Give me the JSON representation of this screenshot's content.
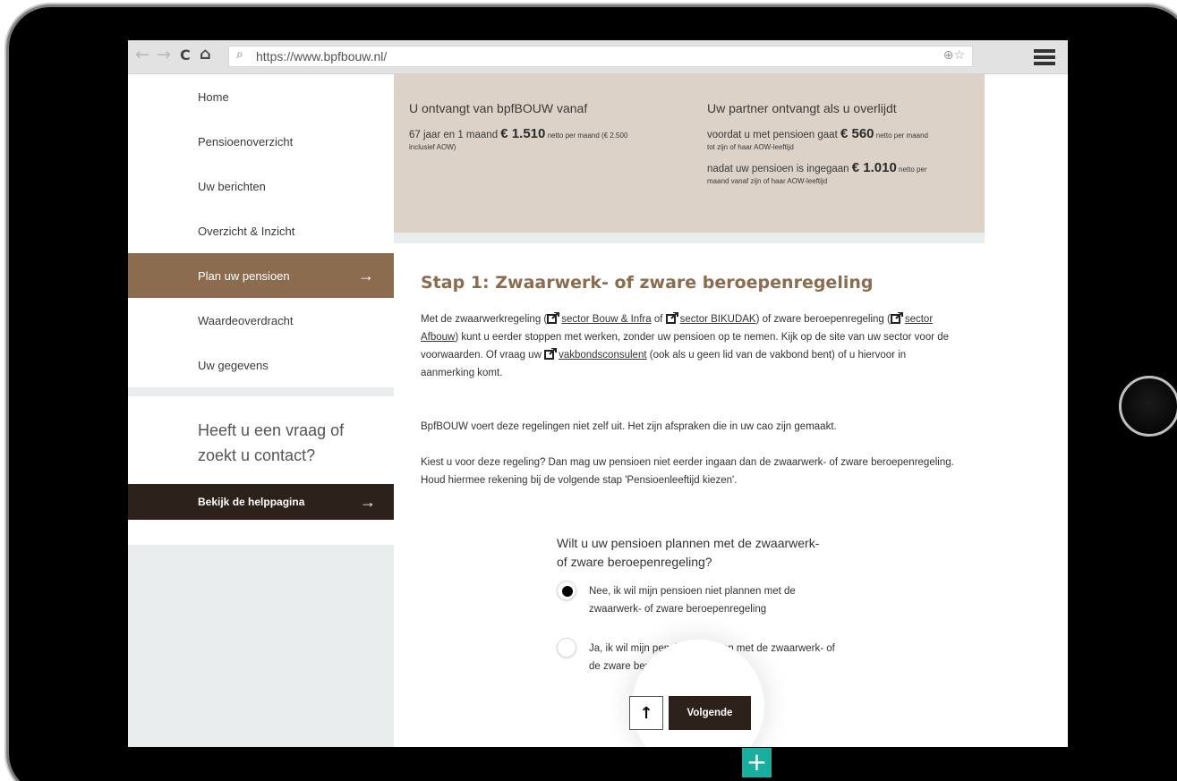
{
  "browser": {
    "back": "←",
    "forward": "→",
    "reload": "C",
    "home": "⌂",
    "url": "https://www.bpfbouw.nl/",
    "url_icons": "⊕☆"
  },
  "sidebar": {
    "items": [
      {
        "label": "Home"
      },
      {
        "label": "Pensioenoverzicht"
      },
      {
        "label": "Uw berichten"
      },
      {
        "label": "Overzicht & Inzicht"
      },
      {
        "label": "Plan uw pensioen",
        "arrow": "→"
      },
      {
        "label": "Waardeoverdracht"
      },
      {
        "label": "Uw gegevens"
      }
    ],
    "help_title": "Heeft u een vraag of zoekt u contact?",
    "help_button": "Bekijk de helppagina",
    "help_arrow": "→"
  },
  "benefit": {
    "left_head": "U ontvangt van bpfBOUW vanaf",
    "left_prefix": "67 jaar en 1 maand ",
    "left_amount": "€ 1.510",
    "left_suffix": " netto per maand (€ 2.500",
    "left_small": "inclusief AOW)",
    "right_head": "Uw partner ontvangt als u overlijdt",
    "right1_prefix": "voordat u met pensioen gaat ",
    "right1_amount": "€ 560",
    "right1_suffix": " netto per maand",
    "right1_small": "tot zijn of haar AOW-leeftijd",
    "right2_prefix": "nadat uw pensioen is ingegaan ",
    "right2_amount": "€ 1.010",
    "right2_suffix": " netto per",
    "right2_small": "maand vanaf zijn of haar AOW-leeftijd"
  },
  "main": {
    "step_title": "Stap 1: Zwaarwerk- of zware beroepenregeling",
    "p1_a": "Met de zwaarwerkregeling (",
    "link1": "sector Bouw & Infra",
    "p1_b": " of ",
    "link2": "sector BIKUDAK",
    "p1_c": ") of zware beroepenregeling (",
    "link3": "sector Afbouw",
    "p1_d": ") kunt u eerder stoppen met werken, zonder uw pensioen op te nemen. Kijk op de site van uw sector voor de voorwaarden. Of vraag uw ",
    "link4": "vakbondsconsulent",
    "p1_e": " (ook als u geen lid van de vakbond bent) of u hiervoor in aanmerking komt.",
    "p2": "BpfBOUW voert deze regelingen niet zelf uit. Het zijn afspraken die in uw cao zijn gemaakt.",
    "p3": "Kiest u voor deze regeling? Dan mag uw pensioen niet eerder ingaan dan de zwaarwerk- of zware beroepenregeling. Houd hiermee rekening bij de volgende stap 'Pensioenleeftijd kiezen'.",
    "question": "Wilt u uw pensioen plannen met de zwaarwerk- of zware beroepenregeling?",
    "option1": "Nee, ik wil mijn pensioen niet plannen met de zwaarwerk- of zware beroepenregeling",
    "option2": "Ja, ik wil mijn pensioen plannen met de zwaarwerk- of de zware beroepenregeling",
    "up_arrow": "↑",
    "next_button": "Volgende"
  },
  "plus_badge": "+"
}
